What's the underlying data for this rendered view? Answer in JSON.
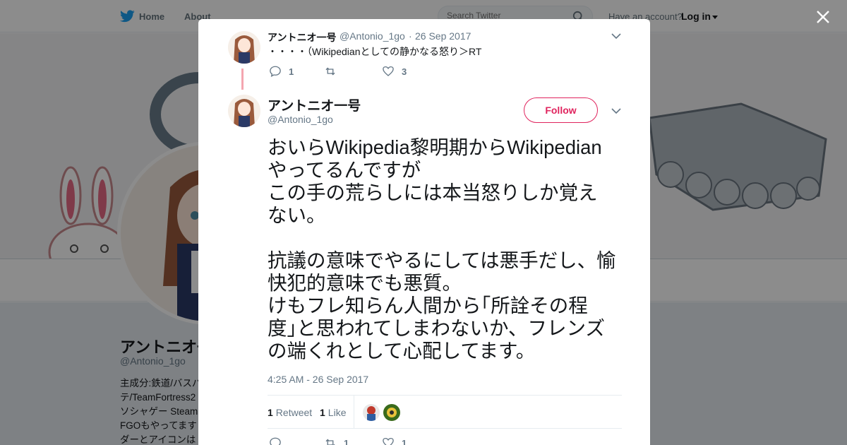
{
  "topbar": {
    "home_label": "Home",
    "about_label": "About",
    "search_placeholder": "Search Twitter",
    "have_account": "Have an account?",
    "login_label": "Log in"
  },
  "profile": {
    "name": "アントニオ一号",
    "handle": "@Antonio_1go",
    "bio": [
      "主成分:鉄道/バスパ",
      "テ/TeamFortress2",
      "ソシャゲー Steam",
      "FGOもやってます",
      "ダーとアイコンは"
    ]
  },
  "modal": {
    "parent_tweet": {
      "name": "アントニオ一号",
      "handle": "@Antonio_1go",
      "separator": "·",
      "date": "26 Sep 2017",
      "text": "・・・・（Wikipedianとしての静かなる怒り＞RT",
      "replies": "1",
      "retweets": "",
      "likes": "3"
    },
    "main_tweet": {
      "name": "アントニオ一号",
      "handle": "@Antonio_1go",
      "follow_label": "Follow",
      "lines_a": [
        "おいらWikipedia黎明期からWikipedian",
        "やってるんですが",
        "この手の荒らしには本当怒りしか覚え",
        "ない。"
      ],
      "lines_b": [
        "抗議の意味でやるにしては悪手だし、愉",
        "快犯的意味でも悪質。",
        "けもフレ知らん人間から｢所詮その程",
        "度｣と思われてしまわないか、フレンズ",
        "の端くれとして心配してます。"
      ],
      "timestamp": "4:25 AM - 26 Sep 2017",
      "retweet_count": "1",
      "retweet_label": "Retweet",
      "like_count": "1",
      "like_label": "Like",
      "replies": "",
      "retweets": "1",
      "likes": "1"
    }
  },
  "colors": {
    "twitter_blue": "#1da1f2",
    "follow_accent": "#e0245e",
    "muted_text": "#657786"
  },
  "icons": [
    "twitter-bird-icon",
    "search-icon",
    "close-icon",
    "reply-icon",
    "retweet-icon",
    "heart-icon",
    "chevron-down-icon"
  ]
}
